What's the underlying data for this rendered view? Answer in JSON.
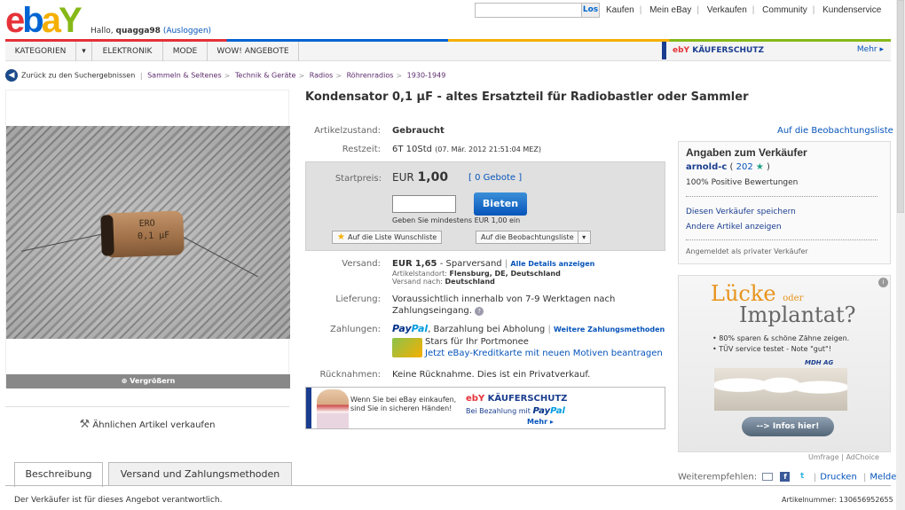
{
  "header": {
    "logo_letters": [
      "e",
      "b",
      "a",
      "Y"
    ],
    "greeting_prefix": "Hallo,",
    "username": "quagga98",
    "logout": "(Ausloggen)",
    "search_button": "Los",
    "links": [
      "Kaufen",
      "Mein eBay",
      "Verkaufen",
      "Community",
      "Kundenservice"
    ]
  },
  "nav": {
    "items": [
      "KATEGORIEN",
      "ELEKTRONIK",
      "MODE",
      "WOW! ANGEBOTE"
    ],
    "kaeuferschutz": "KÄUFERSCHUTZ",
    "kaeuferschutz_prefix": "ebY",
    "more": "Mehr ▸"
  },
  "breadcrumb": {
    "back": "Zurück zu den Suchergebnissen",
    "items": [
      "Sammeln & Seltenes",
      "Technik & Geräte",
      "Radios",
      "Röhrenradios",
      "1930-1949"
    ]
  },
  "image": {
    "capacitor_text1": "ERO",
    "capacitor_text2": "0,1 µF",
    "zoom": "Vergrößern"
  },
  "similar": "Ähnlichen Artikel verkaufen",
  "listing": {
    "title": "Kondensator 0,1 µF - altes Ersatzteil für Radiobastler oder Sammler",
    "condition_label": "Artikelzustand:",
    "condition": "Gebraucht",
    "remaining_label": "Restzeit:",
    "remaining": "6T 10Std",
    "remaining_date": "(07. Mär. 2012 21:51:04 MEZ)",
    "watch_link": "Auf die Beobachtungsliste"
  },
  "bid": {
    "start_label": "Startpreis:",
    "currency": "EUR",
    "price": "1,00",
    "bids": "[ 0 Gebote ]",
    "button": "Bieten",
    "hint": "Geben Sie mindestens EUR 1,00 ein",
    "wishlist": "Auf die Liste Wunschliste",
    "watchlist": "Auf die Beobachtungsliste"
  },
  "shipping": {
    "label": "Versand:",
    "price_currency": "EUR",
    "price": "1,65",
    "method": "- Sparversand",
    "details": "Alle Details anzeigen",
    "location_label": "Artikelstandort:",
    "location": "Flensburg, DE, Deutschland",
    "ship_to_label": "Versand nach:",
    "ship_to": "Deutschland"
  },
  "delivery": {
    "label": "Lieferung:",
    "line1": "Voraussichtlich innerhalb von 7-9 Werktagen nach",
    "line2": "Zahlungseingang."
  },
  "payment": {
    "label": "Zahlungen:",
    "paypal1": "Pay",
    "paypal2": "Pal",
    "text": ", Barzahlung bei Abholung",
    "more": "Weitere Zahlungsmethoden",
    "stars_line": "Stars für Ihr Portmonee",
    "card_line": "Jetzt eBay-Kreditkarte mit neuen Motiven beantragen"
  },
  "returns": {
    "label": "Rücknahmen:",
    "text": "Keine Rücknahme. Dies ist ein Privatverkauf."
  },
  "banner": {
    "line1": "Wenn Sie bei eBay einkaufen,",
    "line2": "sind Sie in sicheren Händen!",
    "brand": "ebY",
    "title": "KÄUFERSCHUTZ",
    "sub": "Bei Bezahlung mit",
    "paypal1": "Pay",
    "paypal2": "Pal",
    "more": "Mehr ▸"
  },
  "seller": {
    "heading": "Angaben zum Verkäufer",
    "name": "arnold-c",
    "score": "202",
    "positive": "100% Positive Bewertungen",
    "save": "Diesen Verkäufer speichern",
    "other": "Andere Artikel anzeigen",
    "note": "Angemeldet als privater Verkäufer"
  },
  "ad": {
    "word1": "Lücke",
    "word2": "oder",
    "word3": "Implantat?",
    "bullet1": "• 80% sparen & schöne Zähne zeigen.",
    "bullet2": "• TÜV service testet - Note \"gut\"!",
    "brand": "MDH AG",
    "button": "--> Infos hier!",
    "footer1": "Umfrage",
    "footer2": "AdChoice"
  },
  "share": {
    "label": "Weiterempfehlen:",
    "print": "Drucken",
    "report": "Melden"
  },
  "tabs": [
    "Beschreibung",
    "Versand und Zahlungsmethoden"
  ],
  "footer": {
    "left": "Der Verkäufer ist für dieses Angebot verantwortlich.",
    "item_number_label": "Artikelnummer:",
    "item_number": "130656952655"
  }
}
